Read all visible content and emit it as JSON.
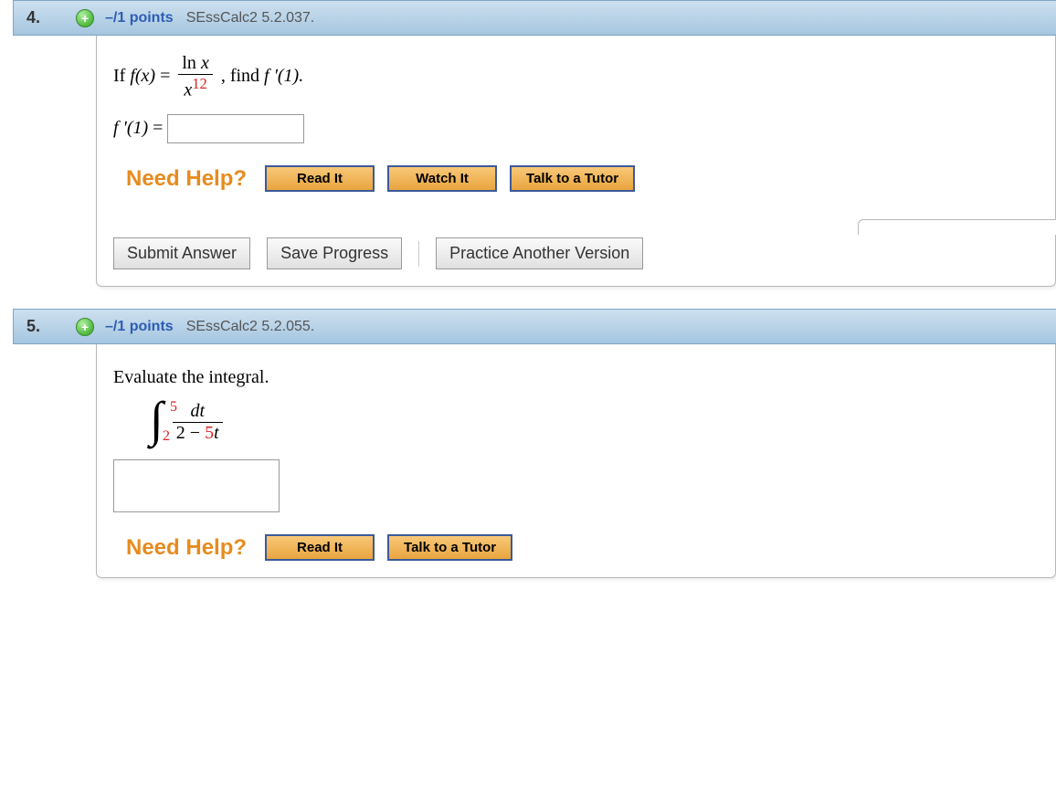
{
  "q4": {
    "number": "4.",
    "points": "–/1 points",
    "problem_id": "SEssCalc2 5.2.037.",
    "prompt_prefix": "If ",
    "func": "f(x)",
    "equals": " = ",
    "frac_num_1": "ln ",
    "frac_num_2": "x",
    "frac_den_1": "x",
    "frac_den_exp": "12",
    "prompt_suffix": ", find ",
    "target": "f '(1).",
    "answer_label_1": "f '(1)",
    "answer_label_2": " = ",
    "need_help": "Need Help?",
    "help_read": "Read It",
    "help_watch": "Watch It",
    "help_tutor": "Talk to a Tutor",
    "submit": "Submit Answer",
    "save": "Save Progress",
    "practice": "Practice Another Version"
  },
  "q5": {
    "number": "5.",
    "points": "–/1 points",
    "problem_id": "SEssCalc2 5.2.055.",
    "prompt": "Evaluate the integral.",
    "upper": "5",
    "lower": "2",
    "frac_num": "dt",
    "frac_den_1": "2 − ",
    "frac_den_coef": "5",
    "frac_den_var": "t",
    "need_help": "Need Help?",
    "help_read": "Read It",
    "help_tutor": "Talk to a Tutor"
  }
}
